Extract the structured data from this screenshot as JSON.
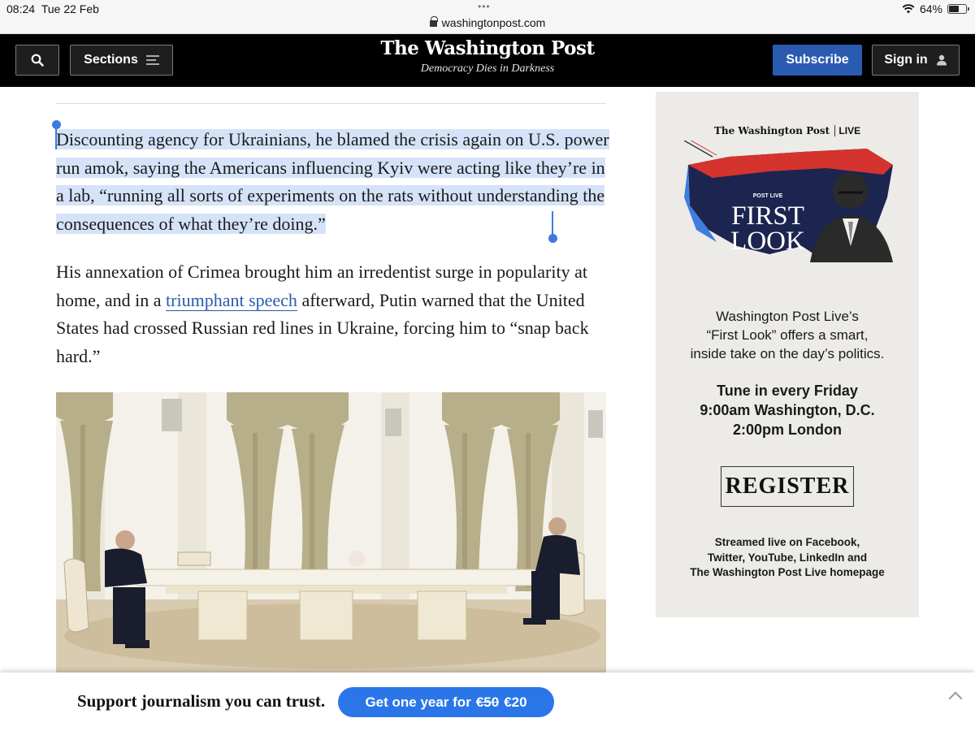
{
  "status_bar": {
    "time": "08:24",
    "date": "Tue 22 Feb",
    "url": "washingtonpost.com",
    "battery": "64%",
    "battery_level": 0.64
  },
  "header": {
    "sections_label": "Sections",
    "logo": "The Washington Post",
    "tagline": "Democracy Dies in Darkness",
    "subscribe_label": "Subscribe",
    "signin_label": "Sign in"
  },
  "article": {
    "para1": "Discounting agency for Ukrainians, he blamed the crisis again on U.S. power run amok, saying the Americans influencing Kyiv were acting like they’re in a lab, “running all sorts of experiments on the rats without understanding the consequences of what they’re doing.”",
    "para2_before": "His annexation of Crimea brought him an irredentist surge in popularity at home, and in a ",
    "para2_link": "triumphant speech",
    "para2_after": " afterward, Putin warned that the United States had crossed Russian red lines in Ukraine, forcing him to “snap back hard.”"
  },
  "ad": {
    "logo": "The Washington Post",
    "logo_live": "LIVE",
    "kicker": "POST LIVE",
    "title_line1": "FIRST",
    "title_line2": "LOOK",
    "desc1": "Washington Post Live’s",
    "desc2": "“First Look” offers a smart,",
    "desc3": "inside take on the day’s politics.",
    "tune1": "Tune in every Friday",
    "tune2": "9:00am Washington, D.C.",
    "tune3": "2:00pm London",
    "register": "REGISTER",
    "stream1": "Streamed live on Facebook,",
    "stream2": "Twitter, YouTube, LinkedIn and",
    "stream3": "The Washington Post Live homepage"
  },
  "footer": {
    "support": "Support journalism you can trust.",
    "offer_prefix": "Get one year for",
    "old_price": "€50",
    "new_price": "€20"
  },
  "colors": {
    "accent_blue": "#2a5bb1",
    "selection": "#d5e3f8",
    "offer_blue": "#2a76e8"
  }
}
